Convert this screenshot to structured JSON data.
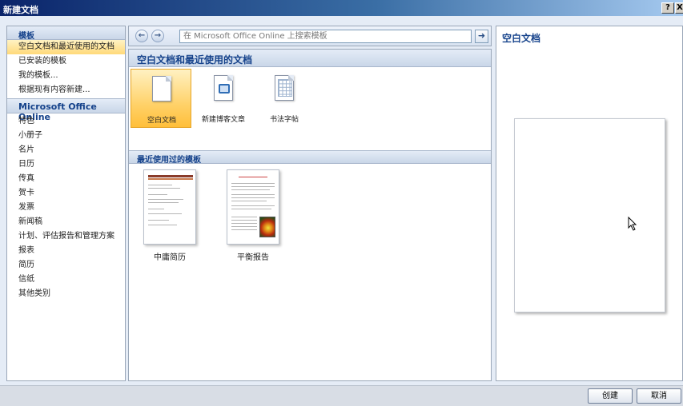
{
  "window": {
    "title": "新建文档",
    "help_label": "?",
    "close_label": "X"
  },
  "sidebar": {
    "header": "模板",
    "items": [
      {
        "label": "空白文档和最近使用的文档",
        "selected": true
      },
      {
        "label": "已安装的模板"
      },
      {
        "label": "我的模板..."
      },
      {
        "label": "根据现有内容新建..."
      }
    ],
    "online_section": "Microsoft Office Online",
    "online_items": [
      {
        "label": "特色"
      },
      {
        "label": "小册子"
      },
      {
        "label": "名片"
      },
      {
        "label": "日历"
      },
      {
        "label": "传真"
      },
      {
        "label": "贺卡"
      },
      {
        "label": "发票"
      },
      {
        "label": "新闻稿"
      },
      {
        "label": "计划、评估报告和管理方案"
      },
      {
        "label": "报表"
      },
      {
        "label": "简历"
      },
      {
        "label": "信纸"
      },
      {
        "label": "其他类别"
      }
    ]
  },
  "search": {
    "back_icon": "back-arrow-icon",
    "forward_icon": "forward-arrow-icon",
    "placeholder": "在 Microsoft Office Online 上搜索模板",
    "go_icon": "arrow-right-icon"
  },
  "main": {
    "section_title": "空白文档和最近使用的文档",
    "templates": [
      {
        "label": "空白文档",
        "icon": "blank-document-icon",
        "selected": true
      },
      {
        "label": "新建博客文章",
        "icon": "blog-post-icon"
      },
      {
        "label": "书法字帖",
        "icon": "calligraphy-grid-icon"
      }
    ],
    "recent_title": "最近使用过的模板",
    "recent": [
      {
        "label": "中庸简历"
      },
      {
        "label": "平衡报告"
      }
    ]
  },
  "preview": {
    "title": "空白文档"
  },
  "footer": {
    "create_label": "创建",
    "cancel_label": "取消"
  },
  "colors": {
    "selection": "#ffd26a",
    "header_text": "#15428b",
    "titlebar": "#0a246a"
  }
}
